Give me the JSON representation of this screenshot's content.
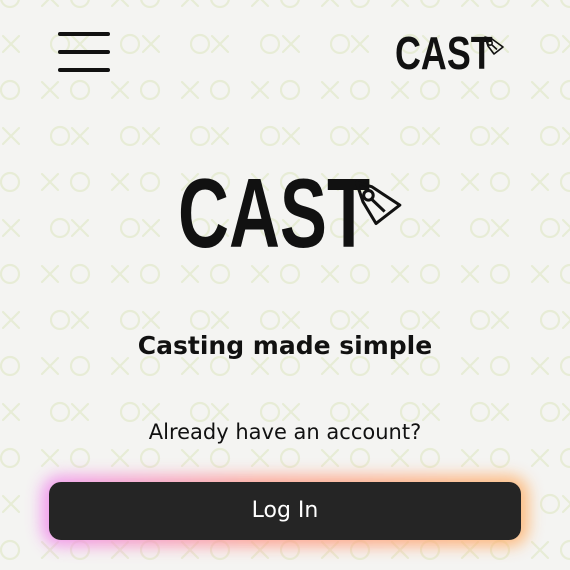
{
  "header": {
    "menu_icon": "hamburger-menu-icon",
    "logo_text": "CAST",
    "logo_icon": "pen-nib-icon"
  },
  "hero": {
    "logo_text": "CAST",
    "logo_icon": "pen-nib-icon",
    "tagline": "Casting made simple"
  },
  "auth": {
    "prompt": "Already have an account?",
    "login_label": "Log In"
  },
  "colors": {
    "background": "#f4f4f2",
    "pattern": "#e7ecd6",
    "button_background": "#252525",
    "button_text": "#ffffff",
    "glow_start": "#f08cf0",
    "glow_end": "#ffb36b",
    "text": "#111111"
  },
  "background_pattern_icon": "tic-tac-toe-x-o-pattern"
}
